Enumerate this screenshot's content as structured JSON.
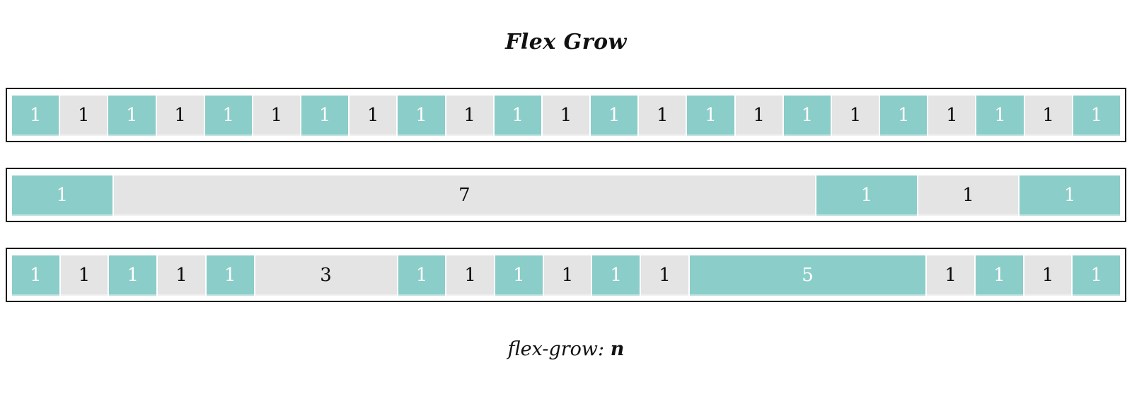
{
  "title": "Flex Grow",
  "caption": {
    "prefix": "flex-grow: ",
    "value": "n"
  },
  "colors": {
    "teal": "#8acdc9",
    "gray": "#e4e4e4",
    "teal_text": "#ffffff",
    "gray_text": "#0d0d0d",
    "container_border": "#1a1a1a",
    "background": "#ffffff"
  },
  "rows": [
    {
      "name": "row-all-ones",
      "cells": [
        {
          "label": "1",
          "grow": 1,
          "color": "teal"
        },
        {
          "label": "1",
          "grow": 1,
          "color": "gray"
        },
        {
          "label": "1",
          "grow": 1,
          "color": "teal"
        },
        {
          "label": "1",
          "grow": 1,
          "color": "gray"
        },
        {
          "label": "1",
          "grow": 1,
          "color": "teal"
        },
        {
          "label": "1",
          "grow": 1,
          "color": "gray"
        },
        {
          "label": "1",
          "grow": 1,
          "color": "teal"
        },
        {
          "label": "1",
          "grow": 1,
          "color": "gray"
        },
        {
          "label": "1",
          "grow": 1,
          "color": "teal"
        },
        {
          "label": "1",
          "grow": 1,
          "color": "gray"
        },
        {
          "label": "1",
          "grow": 1,
          "color": "teal"
        },
        {
          "label": "1",
          "grow": 1,
          "color": "gray"
        },
        {
          "label": "1",
          "grow": 1,
          "color": "teal"
        },
        {
          "label": "1",
          "grow": 1,
          "color": "gray"
        },
        {
          "label": "1",
          "grow": 1,
          "color": "teal"
        },
        {
          "label": "1",
          "grow": 1,
          "color": "gray"
        },
        {
          "label": "1",
          "grow": 1,
          "color": "teal"
        },
        {
          "label": "1",
          "grow": 1,
          "color": "gray"
        },
        {
          "label": "1",
          "grow": 1,
          "color": "teal"
        },
        {
          "label": "1",
          "grow": 1,
          "color": "gray"
        },
        {
          "label": "1",
          "grow": 1,
          "color": "teal"
        },
        {
          "label": "1",
          "grow": 1,
          "color": "gray"
        },
        {
          "label": "1",
          "grow": 1,
          "color": "teal"
        }
      ]
    },
    {
      "name": "row-one-seven",
      "cells": [
        {
          "label": "1",
          "grow": 1,
          "color": "teal"
        },
        {
          "label": "7",
          "grow": 7,
          "color": "gray"
        },
        {
          "label": "1",
          "grow": 1,
          "color": "teal"
        },
        {
          "label": "1",
          "grow": 1,
          "color": "gray"
        },
        {
          "label": "1",
          "grow": 1,
          "color": "teal"
        }
      ]
    },
    {
      "name": "row-mixed",
      "cells": [
        {
          "label": "1",
          "grow": 1,
          "color": "teal"
        },
        {
          "label": "1",
          "grow": 1,
          "color": "gray"
        },
        {
          "label": "1",
          "grow": 1,
          "color": "teal"
        },
        {
          "label": "1",
          "grow": 1,
          "color": "gray"
        },
        {
          "label": "1",
          "grow": 1,
          "color": "teal"
        },
        {
          "label": "3",
          "grow": 3,
          "color": "gray"
        },
        {
          "label": "1",
          "grow": 1,
          "color": "teal"
        },
        {
          "label": "1",
          "grow": 1,
          "color": "gray"
        },
        {
          "label": "1",
          "grow": 1,
          "color": "teal"
        },
        {
          "label": "1",
          "grow": 1,
          "color": "gray"
        },
        {
          "label": "1",
          "grow": 1,
          "color": "teal"
        },
        {
          "label": "1",
          "grow": 1,
          "color": "gray"
        },
        {
          "label": "5",
          "grow": 5,
          "color": "teal"
        },
        {
          "label": "1",
          "grow": 1,
          "color": "gray"
        },
        {
          "label": "1",
          "grow": 1,
          "color": "teal"
        },
        {
          "label": "1",
          "grow": 1,
          "color": "gray"
        },
        {
          "label": "1",
          "grow": 1,
          "color": "teal"
        }
      ]
    }
  ]
}
